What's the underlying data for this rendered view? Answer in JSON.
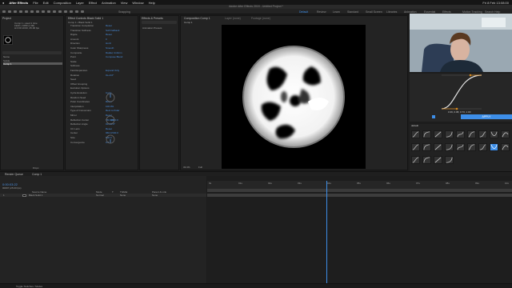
{
  "menubar": {
    "apple": "",
    "app_name": "After Effects",
    "items": [
      "File",
      "Edit",
      "Composition",
      "Layer",
      "Effect",
      "Animation",
      "View",
      "Window",
      "Help"
    ],
    "right_status": "Fri 8 Feb 13:08:00"
  },
  "window_title": "Adobe After Effects 2019 - Untitled Project *",
  "toolbar": {
    "workspaces": [
      "Default",
      "Review",
      "Learn",
      "Standard",
      "Small Screen",
      "Libraries",
      "Animation",
      "Essential",
      "Effects",
      "Motion Tracking",
      "Search Help"
    ],
    "active_workspace": "Default",
    "snapping_label": "Snapping"
  },
  "project_panel": {
    "tab": "Project",
    "comp_info": "Comp 1 • used 1 time",
    "comp_size": "1920 x 1080 (1.00)",
    "comp_duration": "Δ 0:00:10:00, 25.00 fps",
    "search_placeholder": "",
    "header_name": "Name",
    "items": [
      "Solids",
      "Comp 1"
    ],
    "selected_item": "Comp 1",
    "bit_depth": "8 bpc"
  },
  "effect_controls": {
    "tab": "Effect Controls Black Solid 1",
    "breadcrumb": "Comp 1 • Black Solid 1",
    "properties": [
      {
        "name": "Transition Completion",
        "value": "Reset"
      },
      {
        "name": "Transition Softness",
        "value": "Soft Fallback"
      },
      {
        "name": "Ripple",
        "value": "Reset"
      },
      {
        "name": "Amount",
        "value": "0"
      },
      {
        "name": "Direction",
        "value": "Horiz"
      },
      {
        "name": "Color Sharpness",
        "value": "Smooth"
      },
      {
        "name": "Composite",
        "value": "Radial, Uniform"
      },
      {
        "name": "Point",
        "value": "Compose Blend"
      },
      {
        "name": "Scale",
        "value": ""
      },
      {
        "name": "Softness",
        "value": ""
      },
      {
        "name": "Field Expansion",
        "value": "Expand Only"
      },
      {
        "name": "Rotation",
        "value": "0x+0.0°"
      },
      {
        "name": "Seed",
        "value": ""
      },
      {
        "name": "Offset Grouping",
        "value": ""
      },
      {
        "name": "Evolution Options",
        "value": ""
      },
      {
        "name": "Cycle Evolution",
        "value": "Cycle"
      },
      {
        "name": "Random Seed",
        "value": ""
      },
      {
        "name": "Polar Coordinates",
        "value": "Reset"
      },
      {
        "name": "Interpolation",
        "value": "100.0%"
      },
      {
        "name": "Type of Conversion",
        "value": "Rect to Polar"
      },
      {
        "name": "Mirror",
        "value": "Reset"
      },
      {
        "name": "Reflection Center",
        "value": "960.0,540.0"
      },
      {
        "name": "Reflection Angle",
        "value": "0x+90.0°"
      },
      {
        "name": "CC Lens",
        "value": "Reset"
      },
      {
        "name": "Center",
        "value": "960.0,540.0"
      },
      {
        "name": "Size",
        "value": "500.0"
      },
      {
        "name": "Convergence",
        "value": "0.0"
      }
    ]
  },
  "effects_presets": {
    "tab": "Effects & Presets",
    "search_value": "",
    "item": "Animation Presets"
  },
  "composition_panel": {
    "tab": "Composition Comp 1",
    "layer_tab": "Layer (none)",
    "footage_tab": "Footage (none)",
    "breadcrumb": "Comp 1",
    "zoom": "33.3%",
    "quality": "Full",
    "timecode": "0:00:03:22",
    "view": "Active Camera",
    "views": "1 View"
  },
  "flow_panel": {
    "tab": "Flow",
    "readout": "0.39, 0.08, 0.73, 1.00",
    "apply_label": "APPLY",
    "curves_tab": "default",
    "accent": "#3d8ee8"
  },
  "timeline": {
    "render_queue_tab": "Render Queue",
    "comp_tab": "Comp 1",
    "timecode": "0:00:03:22",
    "frame_info": "00097 (25.00 fps)",
    "columns": [
      "Source Name",
      "Mode",
      "T",
      "TrkMat",
      "Parent & Link"
    ],
    "layer": {
      "index": "1",
      "name": "Black Solid 1",
      "mode": "Normal",
      "trkmat": "None",
      "parent": "None"
    },
    "ruler_labels": [
      "0s",
      "01s",
      "02s",
      "03s",
      "04s",
      "05s",
      "06s",
      "07s",
      "08s",
      "09s",
      "10s"
    ],
    "playhead_fraction": 0.39
  },
  "statusbar": {
    "text": "Toggle Switches / Modes"
  },
  "colors": {
    "accent": "#3d8ee8",
    "panel": "#232323",
    "bg": "#1d1d1d"
  }
}
